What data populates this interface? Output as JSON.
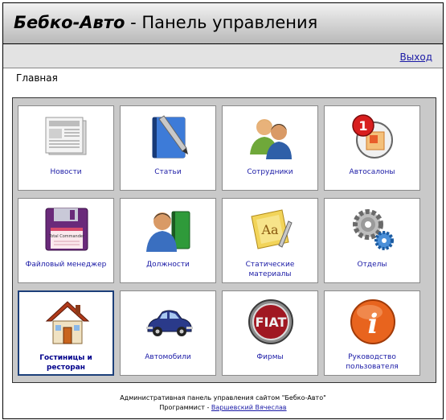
{
  "header": {
    "brand": "Бебко-Авто",
    "title_rest": " - Панель управления"
  },
  "logout_label": "Выход",
  "breadcrumb": "Главная",
  "tiles": [
    {
      "label": "Новости",
      "icon": "newspaper-icon"
    },
    {
      "label": "Статьи",
      "icon": "book-pen-icon"
    },
    {
      "label": "Сотрудники",
      "icon": "people-icon"
    },
    {
      "label": "Автосалоны",
      "icon": "notification-badge-icon",
      "badge": "1"
    },
    {
      "label": "Файловый менеджер",
      "icon": "floppy-disk-icon",
      "floppy_text": "Total Commander"
    },
    {
      "label": "Должности",
      "icon": "person-book-icon"
    },
    {
      "label": "Статические материалы",
      "icon": "font-page-icon",
      "glyph": "Aa"
    },
    {
      "label": "Отделы",
      "icon": "gears-icon"
    },
    {
      "label": "Гостиницы и ресторан",
      "icon": "house-icon"
    },
    {
      "label": "Автомобили",
      "icon": "car-icon"
    },
    {
      "label": "Фирмы",
      "icon": "fiat-logo-icon",
      "logo_text": "FIAT"
    },
    {
      "label": "Руководство пользователя",
      "icon": "info-icon",
      "glyph": "i"
    }
  ],
  "footer": {
    "line1": "Административная панель управления сайтом \"Бебко-Авто\"",
    "programmer_label": "Программист - ",
    "programmer_name": "Варшевский Вячеслав"
  },
  "colors": {
    "link": "#1a1aa6",
    "panel": "#c9c9c9",
    "active_border": "#1c3f7a"
  }
}
